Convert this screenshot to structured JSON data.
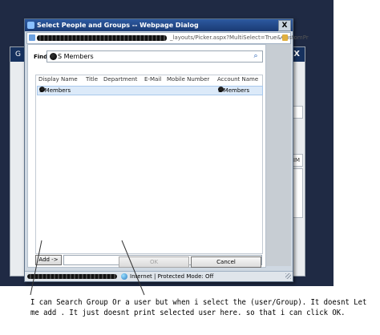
{
  "background_window": {
    "title": "G",
    "close_glyph": "X",
    "fragment_text": "IM"
  },
  "dialog": {
    "title": "Select People and Groups -- Webpage Dialog",
    "url": "_layouts/Picker.aspx?MultiSelect=True&CustomPr",
    "close_label": "X",
    "find_label": "Find",
    "find_value": "S Members",
    "search_icon": "magnifier-icon",
    "columns": [
      "Display Name",
      "Title",
      "Department",
      "E-Mail",
      "Mobile Number",
      "Account Name"
    ],
    "rows": [
      {
        "display_name": "S Members",
        "account_name": "S Members"
      }
    ],
    "add_label": "Add ->",
    "ok_label": "OK",
    "cancel_label": "Cancel",
    "status_zone": "Internet | Protected Mode: Off"
  },
  "annotation": {
    "line1": "I can Search Group Or a user but when i select the (user/Group). It doesnt Let",
    "line2": "me add  . It just doesnt print selected user here. so that i can click OK."
  },
  "colors": {
    "backdrop": "#1f2a44",
    "titlebar": "#1a3a73",
    "selected_row": "#dceaf9"
  }
}
